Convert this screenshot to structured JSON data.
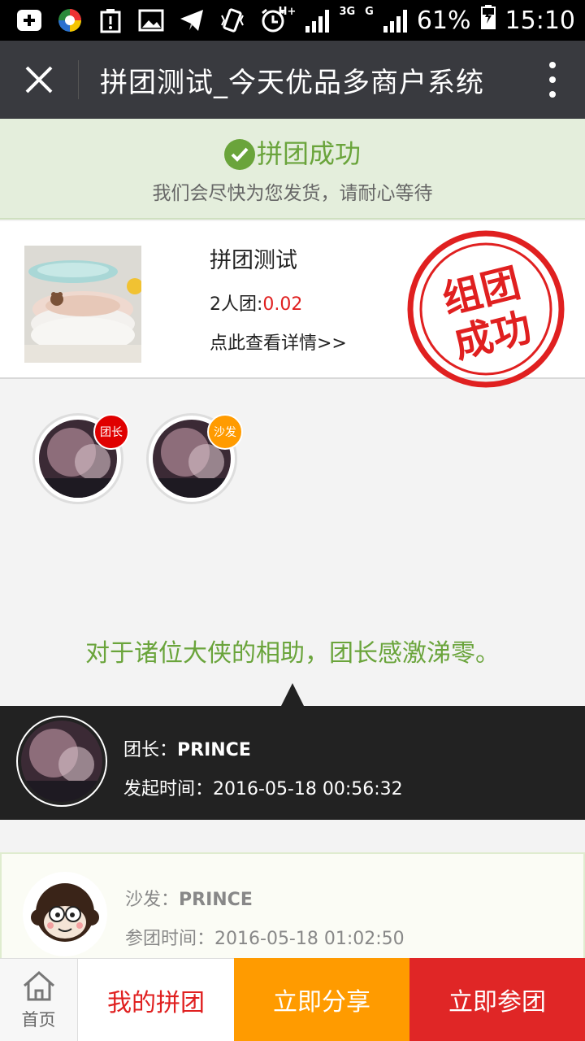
{
  "status_bar": {
    "network_labels": [
      "H+",
      "3G",
      "G"
    ],
    "battery": "61%",
    "time": "15:10",
    "icons": [
      "add-icon",
      "app-icon",
      "warning-battery-icon",
      "image-icon",
      "send-icon",
      "vibrate-icon",
      "alarm-icon",
      "signal-icon",
      "battery-icon"
    ]
  },
  "title_bar": {
    "title": "拼团测试_今天优品多商户系统",
    "close_icon": "close-icon",
    "more_icon": "more-vertical-icon"
  },
  "banner": {
    "title": "拼团成功",
    "subtitle": "我们会尽快为您发货，请耐心等待",
    "color": "#6aa43b"
  },
  "product": {
    "name": "拼团测试",
    "group_label": "2人团:",
    "price": "0.02",
    "link": "点此查看详情>>",
    "stamp_line1": "组团",
    "stamp_line2": "成功",
    "stamp_color": "#e02020"
  },
  "members": [
    {
      "badge": "团长",
      "badge_color": "#e00000"
    },
    {
      "badge": "沙发",
      "badge_color": "#ff9b00"
    }
  ],
  "thanks_text": "对于诸位大侠的相助，团长感激涕零。",
  "leader": {
    "role_label": "团长：",
    "name": "PRINCE",
    "time_label": "发起时间：",
    "time": "2016-05-18 00:56:32"
  },
  "sofa": {
    "role_label": "沙发：",
    "name": "PRINCE",
    "time_label": "参团时间：",
    "time": "2016-05-18 01:02:50"
  },
  "bottom_bar": {
    "home_label": "首页",
    "mine_label": "我的拼团",
    "share_label": "立即分享",
    "join_label": "立即参团"
  }
}
